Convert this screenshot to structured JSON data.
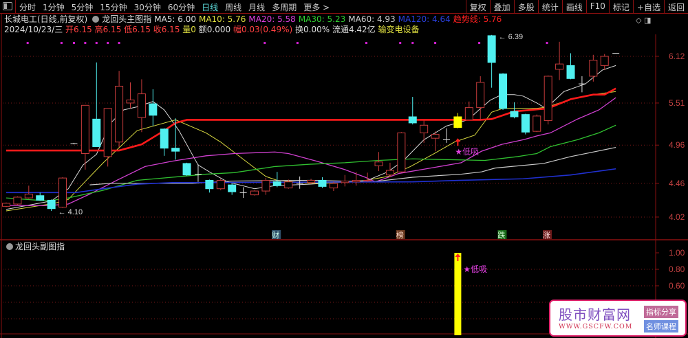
{
  "toolbar": {
    "tabs": [
      "分时",
      "1分钟",
      "5分钟",
      "15分钟",
      "30分钟",
      "60分钟",
      "日线",
      "周线",
      "月线",
      "多周期",
      "更多 >"
    ],
    "active_tab": "日线",
    "right_buttons": [
      "复权",
      "叠加",
      "多股",
      "统计",
      "画线",
      "F10",
      "标记",
      "+自选",
      "返回"
    ]
  },
  "header": {
    "stock": "长城电工(日线,前复权)",
    "indicator": "龙回头主图指",
    "ma": [
      {
        "label": "MA5: 6.00",
        "color": "#e0e0e0"
      },
      {
        "label": "MA10: 5.76",
        "color": "#e0e040"
      },
      {
        "label": "MA20: 5.58",
        "color": "#e040e0"
      },
      {
        "label": "MA30: 5.23",
        "color": "#30d030"
      },
      {
        "label": "MA60: 4.93",
        "color": "#d0d0d0"
      },
      {
        "label": "MA120: 4.64",
        "color": "#2a40e0"
      },
      {
        "label": "趋势线: 5.76",
        "color": "#ff2020"
      }
    ],
    "date": "2024/10/23/三",
    "open": "开6.15",
    "high": "高6.15",
    "low": "低6.15",
    "close": "收6.15",
    "volume": "量0",
    "amount": "额0.000",
    "change": "幅0.03(0.49%)",
    "turnover": "换0.00%",
    "float": "流通4.42亿",
    "sector": "输变电设备"
  },
  "chart_data": {
    "type": "candlestick",
    "y_ticks": [
      "6.12",
      "5.51",
      "4.96",
      "4.46",
      "4.02"
    ],
    "y_tick_values": [
      6.12,
      5.51,
      4.96,
      4.46,
      4.02
    ],
    "ylim": [
      3.85,
      6.45
    ],
    "candles": [
      [
        4.16,
        4.2,
        4.21,
        4.15
      ],
      [
        4.19,
        4.28,
        4.29,
        4.18
      ],
      [
        4.27,
        4.32,
        4.43,
        4.26
      ],
      [
        4.3,
        4.24,
        4.34,
        4.23
      ],
      [
        4.24,
        4.13,
        4.25,
        4.1
      ],
      [
        4.15,
        4.53,
        4.54,
        4.14
      ],
      [
        4.98,
        4.98,
        4.99,
        4.97
      ],
      [
        4.85,
        5.48,
        5.48,
        4.64
      ],
      [
        5.3,
        4.94,
        6.04,
        4.94
      ],
      [
        4.81,
        5.44,
        5.44,
        4.68
      ],
      [
        5.0,
        5.73,
        5.93,
        4.93
      ],
      [
        5.51,
        5.55,
        5.78,
        5.44
      ],
      [
        5.32,
        5.63,
        5.82,
        5.13
      ],
      [
        5.5,
        5.35,
        5.69,
        5.21
      ],
      [
        5.17,
        4.92,
        5.18,
        4.82
      ],
      [
        4.92,
        4.88,
        5.31,
        4.77
      ],
      [
        4.72,
        4.57,
        4.73,
        4.56
      ],
      [
        4.58,
        4.58,
        4.71,
        4.48
      ],
      [
        4.5,
        4.39,
        4.51,
        4.34
      ],
      [
        4.39,
        4.5,
        4.52,
        4.37
      ],
      [
        4.44,
        4.35,
        4.46,
        4.31
      ],
      [
        4.34,
        4.34,
        4.41,
        4.27
      ],
      [
        4.31,
        4.36,
        4.37,
        4.3
      ],
      [
        4.36,
        4.5,
        4.53,
        4.31
      ],
      [
        4.48,
        4.43,
        4.61,
        4.41
      ],
      [
        4.4,
        4.48,
        4.51,
        4.39
      ],
      [
        4.46,
        4.46,
        4.55,
        4.39
      ],
      [
        4.47,
        4.5,
        4.52,
        4.45
      ],
      [
        4.5,
        4.42,
        4.54,
        4.4
      ],
      [
        4.4,
        4.46,
        4.48,
        4.36
      ],
      [
        4.47,
        4.49,
        4.57,
        4.42
      ],
      [
        4.48,
        4.5,
        4.61,
        4.43
      ],
      [
        4.49,
        4.5,
        4.6,
        4.48
      ],
      [
        4.69,
        4.74,
        4.87,
        4.62
      ],
      [
        4.57,
        4.63,
        4.73,
        4.54
      ],
      [
        4.61,
        5.12,
        5.13,
        4.6
      ],
      [
        5.33,
        5.25,
        5.59,
        5.23
      ],
      [
        5.12,
        5.22,
        5.28,
        4.99
      ],
      [
        5.05,
        5.1,
        5.14,
        4.88
      ],
      [
        5.03,
        5.03,
        5.18,
        4.99
      ],
      [
        5.19,
        5.33,
        5.38,
        5.18
      ],
      [
        5.29,
        5.45,
        5.53,
        5.29
      ],
      [
        5.45,
        5.78,
        5.86,
        5.28
      ],
      [
        6.39,
        6.04,
        6.4,
        5.71
      ],
      [
        5.89,
        5.44,
        5.9,
        5.42
      ],
      [
        5.4,
        5.33,
        5.52,
        5.31
      ],
      [
        5.36,
        5.13,
        5.37,
        5.1
      ],
      [
        5.14,
        5.34,
        5.36,
        5.13
      ],
      [
        5.28,
        5.86,
        5.87,
        5.23
      ],
      [
        5.95,
        6.02,
        6.31,
        5.81
      ],
      [
        6.0,
        5.83,
        6.16,
        5.82
      ],
      [
        5.76,
        5.76,
        5.86,
        5.65
      ],
      [
        5.86,
        6.07,
        6.14,
        5.79
      ],
      [
        6.0,
        6.12,
        6.15,
        5.94
      ],
      [
        6.16,
        6.16,
        6.16,
        6.16
      ]
    ],
    "highlight_candle": 40,
    "lines": [
      {
        "name": "MA5",
        "color": "#d8d8d8",
        "width": 1,
        "points": [
          [
            0,
            4.12
          ],
          [
            4,
            4.23
          ],
          [
            5.5,
            4.39
          ],
          [
            6.8,
            4.7
          ],
          [
            8,
            4.84
          ],
          [
            9.2,
            5.24
          ],
          [
            10.4,
            5.42
          ],
          [
            11.6,
            5.46
          ],
          [
            13,
            5.53
          ],
          [
            14,
            5.42
          ],
          [
            15.3,
            5.15
          ],
          [
            17,
            4.7
          ],
          [
            18,
            4.61
          ],
          [
            19.6,
            4.48
          ],
          [
            22,
            4.39
          ],
          [
            23.8,
            4.43
          ],
          [
            27,
            4.45
          ],
          [
            30,
            4.48
          ],
          [
            32,
            4.5
          ],
          [
            33.8,
            4.61
          ],
          [
            35.2,
            4.76
          ],
          [
            37,
            5.03
          ],
          [
            39,
            5.21
          ],
          [
            40.9,
            5.29
          ],
          [
            42.1,
            5.45
          ],
          [
            42.9,
            5.55
          ],
          [
            43.9,
            5.62
          ],
          [
            45,
            5.62
          ],
          [
            45.8,
            5.6
          ],
          [
            47,
            5.51
          ],
          [
            47.8,
            5.44
          ],
          [
            49.4,
            5.66
          ],
          [
            51.3,
            5.76
          ],
          [
            52.8,
            5.94
          ],
          [
            54,
            6.0
          ]
        ]
      },
      {
        "name": "MA10",
        "color": "#d8d840",
        "width": 1,
        "points": [
          [
            0,
            4.1
          ],
          [
            4.3,
            4.2
          ],
          [
            5.5,
            4.25
          ],
          [
            7.1,
            4.5
          ],
          [
            8.6,
            4.73
          ],
          [
            10.1,
            4.94
          ],
          [
            11.6,
            5.15
          ],
          [
            15,
            5.29
          ],
          [
            17.7,
            5.12
          ],
          [
            19,
            5.0
          ],
          [
            21.4,
            4.73
          ],
          [
            23,
            4.55
          ],
          [
            24,
            4.5
          ],
          [
            27,
            4.46
          ],
          [
            31.1,
            4.48
          ],
          [
            33.8,
            4.55
          ],
          [
            35.8,
            4.68
          ],
          [
            37.8,
            4.84
          ],
          [
            39.7,
            5.0
          ],
          [
            41.5,
            5.09
          ],
          [
            42.1,
            5.21
          ],
          [
            43,
            5.39
          ],
          [
            44,
            5.44
          ],
          [
            47,
            5.44
          ],
          [
            48,
            5.46
          ],
          [
            50,
            5.56
          ],
          [
            52,
            5.62
          ],
          [
            54,
            5.66
          ]
        ]
      },
      {
        "name": "MA20",
        "color": "#d040d0",
        "width": 1.3,
        "points": [
          [
            0,
            4.17
          ],
          [
            3.7,
            4.17
          ],
          [
            5.5,
            4.19
          ],
          [
            7.4,
            4.32
          ],
          [
            9.8,
            4.5
          ],
          [
            12.3,
            4.68
          ],
          [
            14.7,
            4.75
          ],
          [
            17.7,
            4.82
          ],
          [
            20.2,
            4.85
          ],
          [
            23.8,
            4.87
          ],
          [
            25,
            4.85
          ],
          [
            27.5,
            4.75
          ],
          [
            30,
            4.64
          ],
          [
            31.8,
            4.54
          ],
          [
            32.7,
            4.48
          ],
          [
            34.8,
            4.59
          ],
          [
            37.2,
            4.65
          ],
          [
            40.3,
            4.73
          ],
          [
            42.1,
            4.88
          ],
          [
            43.9,
            4.97
          ],
          [
            45.8,
            5.03
          ],
          [
            47,
            5.08
          ],
          [
            48.2,
            5.12
          ],
          [
            50.6,
            5.3
          ],
          [
            52.5,
            5.42
          ],
          [
            54,
            5.58
          ]
        ]
      },
      {
        "name": "MA30",
        "color": "#30c030",
        "width": 1.3,
        "points": [
          [
            0,
            4.27
          ],
          [
            3.7,
            4.23
          ],
          [
            5.5,
            4.27
          ],
          [
            8.6,
            4.37
          ],
          [
            11.6,
            4.5
          ],
          [
            14.7,
            4.54
          ],
          [
            17.7,
            4.58
          ],
          [
            20.2,
            4.6
          ],
          [
            23.8,
            4.68
          ],
          [
            26.9,
            4.71
          ],
          [
            30,
            4.73
          ],
          [
            33,
            4.76
          ],
          [
            36,
            4.78
          ],
          [
            39.1,
            4.77
          ],
          [
            42.4,
            4.76
          ],
          [
            45.3,
            4.81
          ],
          [
            47,
            4.85
          ],
          [
            48.2,
            4.94
          ],
          [
            50.6,
            5.03
          ],
          [
            52.5,
            5.12
          ],
          [
            54,
            5.22
          ]
        ]
      },
      {
        "name": "MA60",
        "color": "#c8c8c8",
        "width": 1.2,
        "points": [
          [
            7.4,
            4.44
          ],
          [
            9.2,
            4.46
          ],
          [
            16.5,
            4.46
          ],
          [
            20,
            4.49
          ],
          [
            27,
            4.5
          ],
          [
            32.4,
            4.48
          ],
          [
            36,
            4.54
          ],
          [
            40.3,
            4.58
          ],
          [
            42.1,
            4.61
          ],
          [
            43.3,
            4.66
          ],
          [
            47.6,
            4.72
          ],
          [
            50,
            4.81
          ],
          [
            54,
            4.93
          ]
        ]
      },
      {
        "name": "MA120",
        "color": "#2030d0",
        "width": 1.6,
        "points": [
          [
            0,
            4.34
          ],
          [
            6.2,
            4.34
          ],
          [
            8.6,
            4.39
          ],
          [
            11.6,
            4.45
          ],
          [
            14.7,
            4.47
          ],
          [
            36,
            4.48
          ],
          [
            40.3,
            4.5
          ],
          [
            45.8,
            4.52
          ],
          [
            50,
            4.57
          ],
          [
            54,
            4.65
          ]
        ]
      },
      {
        "name": "趋势线",
        "color": "#ff1a1a",
        "width": 2.6,
        "points": [
          [
            0,
            4.89
          ],
          [
            10,
            4.89
          ],
          [
            12,
            4.97
          ],
          [
            14,
            5.15
          ],
          [
            15,
            5.25
          ],
          [
            16,
            5.29
          ],
          [
            42,
            5.29
          ],
          [
            43,
            5.3
          ],
          [
            45,
            5.4
          ],
          [
            48,
            5.44
          ],
          [
            49,
            5.5
          ],
          [
            50,
            5.56
          ],
          [
            52,
            5.62
          ],
          [
            53,
            5.62
          ],
          [
            54,
            5.7
          ]
        ]
      }
    ],
    "annotations": [
      {
        "text": "6.39",
        "index": 43,
        "value": 6.39
      },
      {
        "text": "4.10",
        "index": 4,
        "value": 4.1
      }
    ],
    "signal": {
      "text": "★低吸",
      "index": 40,
      "value": 4.96
    },
    "top_dot_indices": [
      1.9,
      4.9,
      6,
      7,
      8,
      9,
      10,
      22.9,
      25.8,
      31.9,
      34.9,
      36,
      38,
      41.9,
      47.9
    ],
    "bottom_tags": [
      {
        "text": "财",
        "index": 23.9,
        "bg": "#30506a",
        "color": "#cfe"
      },
      {
        "text": "榜",
        "index": 34.9,
        "bg": "#6a3a20",
        "color": "#fdc"
      },
      {
        "text": "跌",
        "index": 43.9,
        "bg": "#1a6a1a",
        "color": "#dfd"
      },
      {
        "text": "涨",
        "index": 47.9,
        "bg": "#6a1a1a",
        "color": "#fdd"
      }
    ]
  },
  "sub_chart": {
    "title": "龙回头副图指",
    "y_ticks": [
      "1.00",
      "0.80",
      "0.60"
    ],
    "y_tick_values": [
      1.0,
      0.8,
      0.6
    ],
    "bars": [
      {
        "index": 40,
        "value": 1.0
      }
    ],
    "signal": {
      "text": "★低吸",
      "index": 40
    }
  },
  "watermark": {
    "name": "股市财富网",
    "url": "WWW.GSCFW.COM",
    "badge1": "指标分享",
    "badge2": "名师课程"
  }
}
